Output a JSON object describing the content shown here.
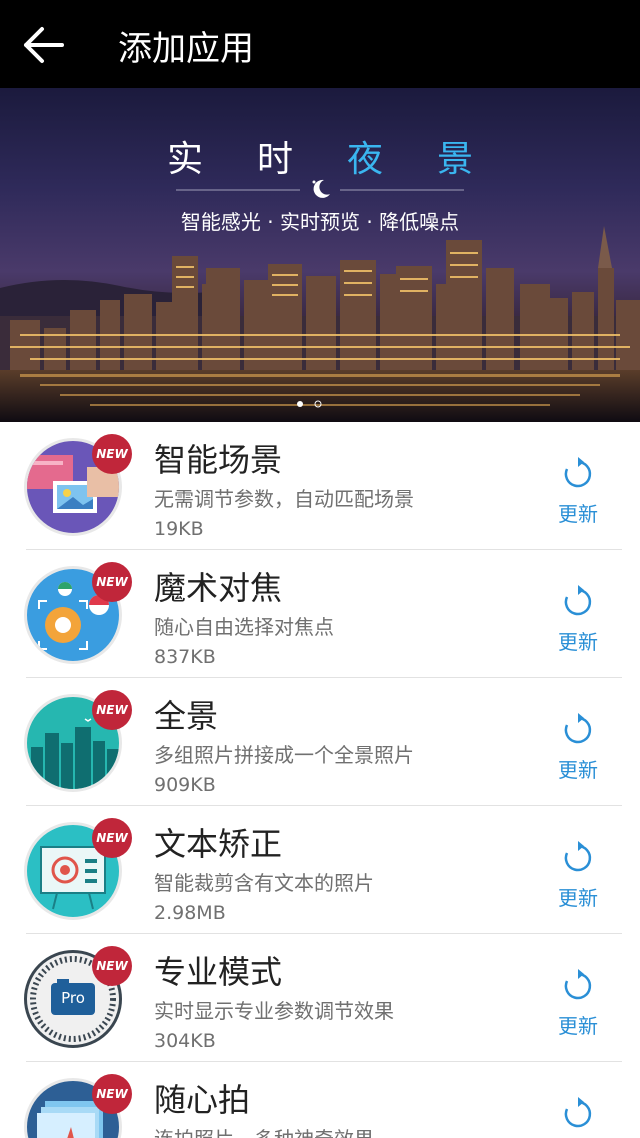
{
  "header": {
    "title": "添加应用"
  },
  "banner": {
    "title_white": "实时",
    "title_blue": "夜景",
    "subtitle": "智能感光 · 实时预览 · 降低噪点"
  },
  "apps": [
    {
      "name": "智能场景",
      "desc": "无需调节参数，自动匹配场景",
      "size": "19KB",
      "badge": "NEW",
      "action": "更新",
      "icon": "smart-scene-icon"
    },
    {
      "name": "魔术对焦",
      "desc": "随心自由选择对焦点",
      "size": "837KB",
      "badge": "NEW",
      "action": "更新",
      "icon": "magic-focus-icon"
    },
    {
      "name": "全景",
      "desc": "多组照片拼接成一个全景照片",
      "size": "909KB",
      "badge": "NEW",
      "action": "更新",
      "icon": "panorama-icon"
    },
    {
      "name": "文本矫正",
      "desc": "智能裁剪含有文本的照片",
      "size": "2.98MB",
      "badge": "NEW",
      "action": "更新",
      "icon": "document-correction-icon"
    },
    {
      "name": "专业模式",
      "desc": "实时显示专业参数调节效果",
      "size": "304KB",
      "badge": "NEW",
      "action": "更新",
      "icon": "pro-mode-icon",
      "icon_text": "Pro"
    },
    {
      "name": "随心拍",
      "desc": "连拍照片，多种神奇效果",
      "size": "",
      "badge": "NEW",
      "action": "更新",
      "icon": "free-shot-icon"
    }
  ],
  "colors": {
    "accent": "#2a8fd6",
    "badge": "#c0263a",
    "topbar": "#000000"
  }
}
